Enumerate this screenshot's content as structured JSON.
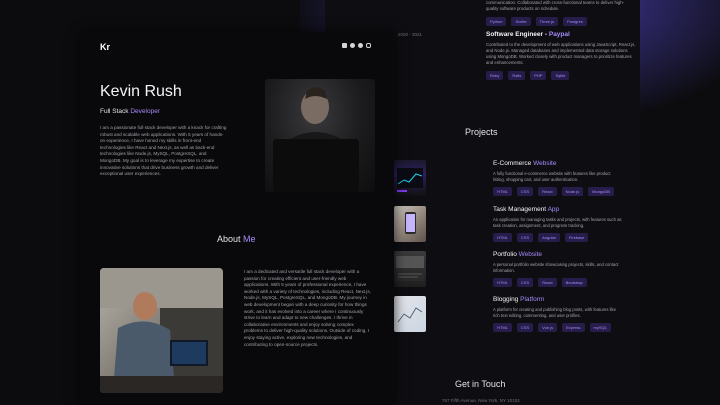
{
  "experience": {
    "top_text": "communication. Collaborated with cross-functional teams to deliver high-quality software products on schedule.",
    "top_tags": [
      "Python",
      "Svelte",
      "Three.js",
      "Postgres"
    ],
    "date": "2020 - 2021",
    "job2_title": "Software Engineer - ",
    "job2_company": "Paypal",
    "job2_text": "Contributed to the development of web applications using JavaScript, React.js, and Node.js. Managed databases and implemented data storage solutions using MongoDB. Worked closely with product managers to prioritize features and enhancements.",
    "job2_tags": [
      "Ruby",
      "Rails",
      "PHP",
      "Sqlite"
    ]
  },
  "projects": {
    "title": "Projects",
    "items": [
      {
        "name_a": "E-Commerce ",
        "name_b": "Website",
        "desc": "A fully functional e-commerce website with features like product listing, shopping cart, and user authentication.",
        "tags": [
          "HTML",
          "CSS",
          "React",
          "Node.js",
          "MongoDB"
        ]
      },
      {
        "name_a": "Task Management ",
        "name_b": "App",
        "desc": "An application for managing tasks and projects, with features such as task creation, assignment, and progress tracking.",
        "tags": [
          "HTML",
          "CSS",
          "Angular",
          "Firebase"
        ]
      },
      {
        "name_a": "Portfolio ",
        "name_b": "Website",
        "desc": "A personal portfolio website showcasing projects, skills, and contact information.",
        "tags": [
          "HTML",
          "CSS",
          "React",
          "Bootstrap"
        ]
      },
      {
        "name_a": "Blogging ",
        "name_b": "Platform",
        "desc": "A platform for creating and publishing blog posts, with features like rich text editing, commenting, and user profiles.",
        "tags": [
          "HTML",
          "CSS",
          "Vue.js",
          "Express",
          "mySQL"
        ]
      }
    ]
  },
  "hero": {
    "logo": "Kr",
    "name": "Kevin Rush",
    "role_a": "Full Stack ",
    "role_b": "Developer",
    "bio": "I am a passionate full stack developer with a knack for crafting robust and scalable web applications. With 5 years of hands-on experience, I have honed my skills in front-end technologies like React and Next.js, as well as back-end technologies like Node.js, MySQL, PostgreSQL, and MongoDB. My goal is to leverage my expertise to create innovative solutions that drive business growth and deliver exceptional user experiences.",
    "socials": [
      "linkedin-icon",
      "github-icon",
      "facebook-icon",
      "instagram-icon"
    ]
  },
  "about": {
    "title_a": "About ",
    "title_b": "Me",
    "text": "I am a dedicated and versatile full stack developer with a passion for creating efficient and user-friendly web applications. With 5 years of professional experience, I have worked with a variety of technologies, including React, Next.js, Node.js, MySQL, PostgreSQL, and MongoDB. My journey in web development began with a deep curiosity for how things work, and it has evolved into a career where I continuously strive to learn and adapt to new challenges. I thrive in collaborative environments and enjoy solving complex problems to deliver high-quality solutions. Outside of coding, I enjoy staying active, exploring new technologies, and contributing to open-source projects."
  },
  "contact": {
    "title": "Get in Touch",
    "address": "767 Fifth Avenue, New York, NY 10153"
  },
  "colors": {
    "accent": "#a78bfa",
    "background": "#09090b",
    "tag_bg": "#261d4a"
  }
}
